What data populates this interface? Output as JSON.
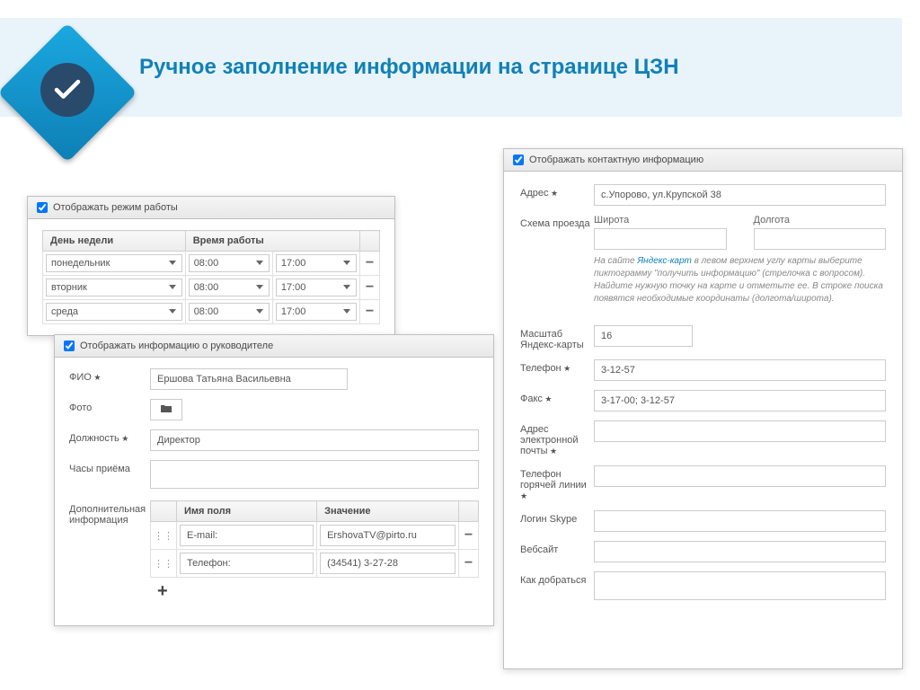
{
  "title": "Ручное заполнение информации на странице ЦЗН",
  "schedule": {
    "header": "Отображать режим работы",
    "cols": {
      "day": "День недели",
      "time": "Время работы"
    },
    "rows": [
      {
        "day": "понедельник",
        "from": "08:00",
        "to": "17:00"
      },
      {
        "day": "вторник",
        "from": "08:00",
        "to": "17:00"
      },
      {
        "day": "среда",
        "from": "08:00",
        "to": "17:00"
      }
    ]
  },
  "director": {
    "header": "Отображать информацию о руководителе",
    "labels": {
      "fio": "ФИО",
      "photo": "Фото",
      "position": "Должность",
      "hours": "Часы приёма",
      "addinfo": "Дополнительная информация"
    },
    "values": {
      "fio": "Ершова Татьяна Васильевна",
      "position": "Директор"
    },
    "addtable": {
      "cols": {
        "name": "Имя поля",
        "value": "Значение"
      },
      "rows": [
        {
          "name": "E-mail:",
          "value": "ErshovaTV@pirto.ru"
        },
        {
          "name": "Телефон:",
          "value": "(34541) 3-27-28"
        }
      ]
    }
  },
  "contact": {
    "header": "Отображать контактную информацию",
    "labels": {
      "address": "Адрес",
      "route": "Схема проезда",
      "lat": "Широта",
      "lon": "Долгота",
      "scale": "Масштаб Яндекс-карты",
      "phone": "Телефон",
      "fax": "Факс",
      "email": "Адрес электронной почты",
      "hotline": "Телефон горячей линии",
      "skype": "Логин Skype",
      "website": "Вебсайт",
      "directions": "Как добраться"
    },
    "values": {
      "address": "с.Упорово, ул.Крупской 38",
      "scale": "16",
      "phone": "3-12-57",
      "fax": "3-17-00; 3-12-57"
    },
    "hint_pre": "На сайте ",
    "hint_link": "Яндекс-карт",
    "hint_post": " в левом верхнем углу карты выберите пиктограмму \"получить информацию\" (стрелочка с вопросом). Найдите нужную точку на карте и отметьте ее. В строке поиска появятся необходимые координаты (долгота/широта)."
  }
}
